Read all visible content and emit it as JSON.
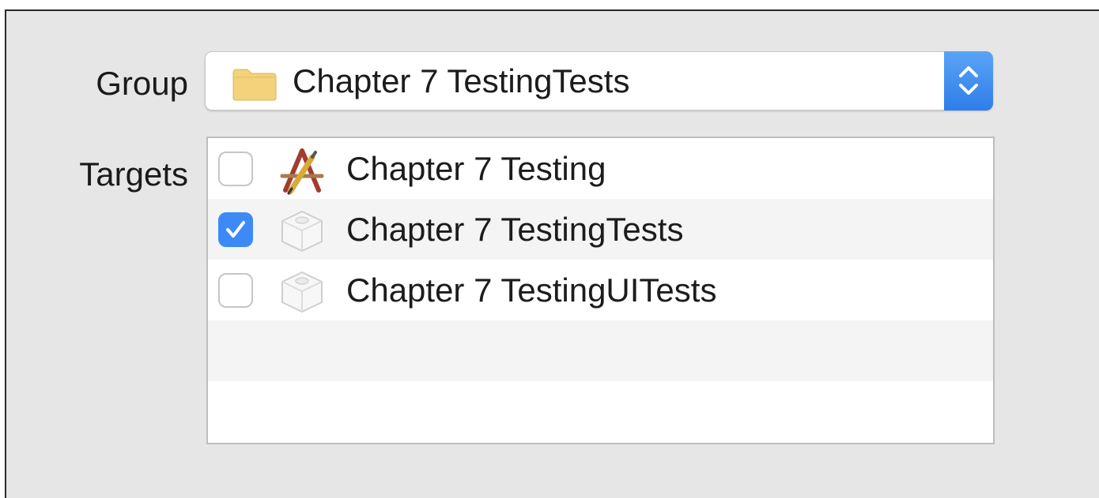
{
  "labels": {
    "group": "Group",
    "targets": "Targets"
  },
  "group_popup": {
    "value": "Chapter 7 TestingTests",
    "icon": "folder-icon"
  },
  "targets": [
    {
      "label": "Chapter 7 Testing",
      "checked": false,
      "icon": "app-target-icon"
    },
    {
      "label": "Chapter 7 TestingTests",
      "checked": true,
      "icon": "test-bundle-icon"
    },
    {
      "label": "Chapter 7 TestingUITests",
      "checked": false,
      "icon": "test-bundle-icon"
    }
  ],
  "colors": {
    "accent": "#3d8af7",
    "panel_bg": "#e6e6e6",
    "folder": "#f2d27a"
  }
}
